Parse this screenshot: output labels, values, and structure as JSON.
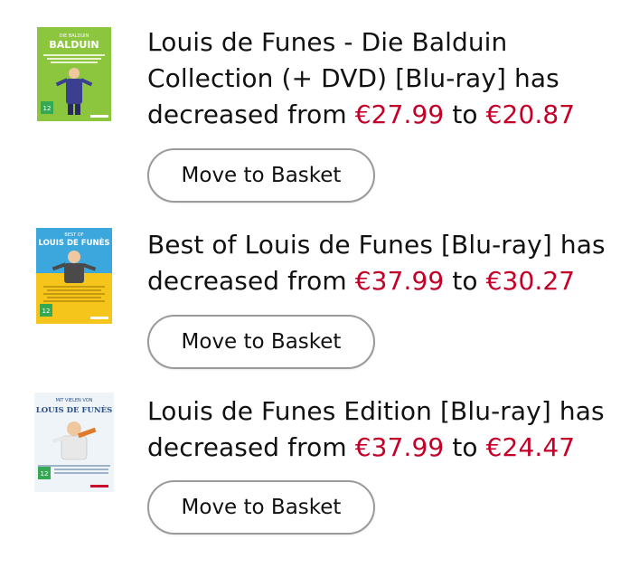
{
  "items": [
    {
      "title": "Louis de Funes - Die Balduin Collection (+ DVD) [Blu-ray]",
      "has_text": " has decreased from ",
      "old_price": "€27.99",
      "to_text": " to ",
      "new_price": "€20.87",
      "button_label": "Move to Basket",
      "cover": {
        "heading": "BALDUIN",
        "top_text": "DIE BALDUIN",
        "rating": "12",
        "bg_color": "#8cc63f"
      }
    },
    {
      "title": "Best of Louis de Funes [Blu-ray]",
      "has_text": " has decreased from ",
      "old_price": "€37.99",
      "to_text": " to ",
      "new_price": "€30.27",
      "button_label": "Move to Basket",
      "cover": {
        "heading": "LOUIS DE FUNÈS",
        "top_text": "BEST OF",
        "rating": "12",
        "bg_color": "#f5c51c"
      }
    },
    {
      "title": "Louis de Funes Edition [Blu-ray]",
      "has_text": " has decreased from ",
      "old_price": "€37.99",
      "to_text": " to ",
      "new_price": "€24.47",
      "button_label": "Move to Basket",
      "cover": {
        "heading": "LOUIS DE FUNÈS",
        "top_text": "MIT VIELEN VON",
        "rating": "12",
        "bg_color": "#eef4f8"
      }
    }
  ],
  "colors": {
    "price": "#c40028",
    "button_border": "#9a9a9a"
  }
}
